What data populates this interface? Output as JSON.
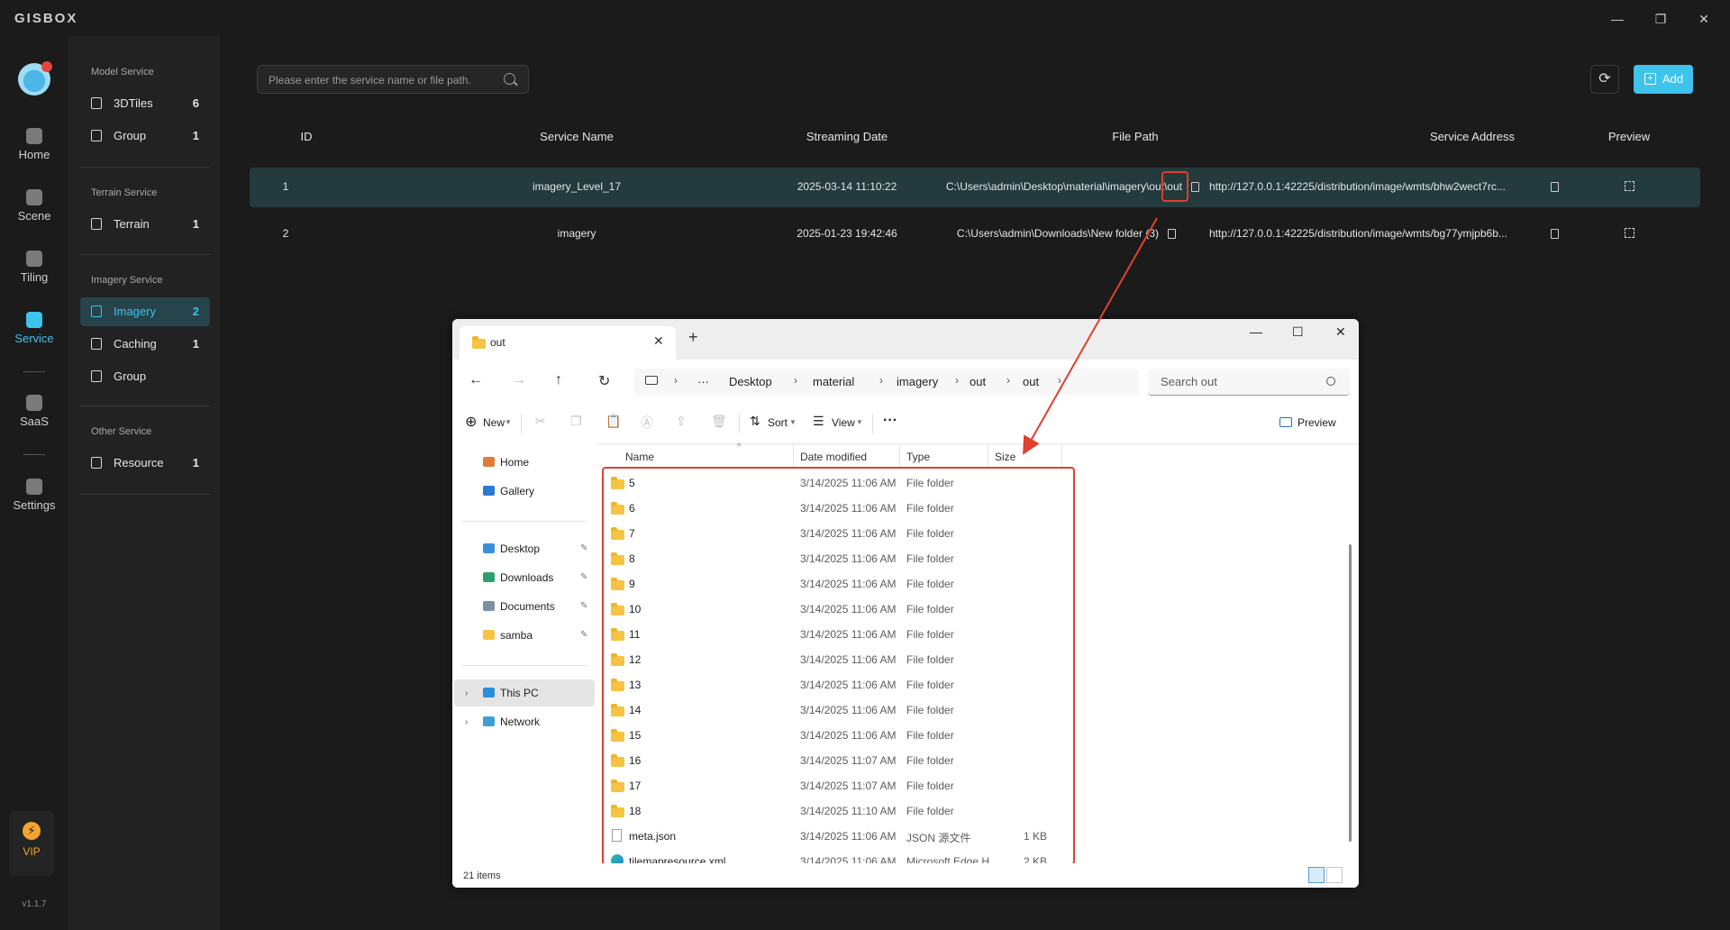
{
  "app": {
    "logo": "GISBOX",
    "window_controls": {
      "minimize": "—",
      "restore": "❐",
      "close": "✕"
    },
    "version": "v1.1.7"
  },
  "rail": {
    "items": [
      {
        "label": "Home",
        "icon": "home-icon"
      },
      {
        "label": "Scene",
        "icon": "scene-icon"
      },
      {
        "label": "Tiling",
        "icon": "tiling-icon"
      },
      {
        "label": "Service",
        "icon": "service-icon",
        "active": true
      },
      {
        "label": "SaaS",
        "icon": "saas-icon"
      },
      {
        "label": "Settings",
        "icon": "settings-icon"
      }
    ],
    "vip_label": "VIP",
    "vip_glyph": "⚡"
  },
  "sidebar": {
    "sections": [
      {
        "title": "Model Service",
        "items": [
          {
            "label": "3DTiles",
            "count": "6"
          },
          {
            "label": "Group",
            "count": "1"
          }
        ]
      },
      {
        "title": "Terrain Service",
        "items": [
          {
            "label": "Terrain",
            "count": "1"
          }
        ]
      },
      {
        "title": "Imagery Service",
        "items": [
          {
            "label": "Imagery",
            "count": "2",
            "active": true
          },
          {
            "label": "Caching",
            "count": "1"
          },
          {
            "label": "Group",
            "count": ""
          }
        ]
      },
      {
        "title": "Other Service",
        "items": [
          {
            "label": "Resource",
            "count": "1"
          }
        ]
      }
    ]
  },
  "main": {
    "search_placeholder": "Please enter the service name or file path.",
    "refresh_glyph": "⟳",
    "add_label": "Add",
    "add_glyph": "+",
    "columns": [
      "ID",
      "Service Name",
      "Streaming Date",
      "File Path",
      "Service Address",
      "Preview"
    ],
    "rows": [
      {
        "id": "1",
        "name": "imagery_Level_17",
        "date": "2025-03-14 11:10:22",
        "path": "C:\\Users\\admin\\Desktop\\material\\imagery\\out\\out",
        "address": "http://127.0.0.1:42225/distribution/image/wmts/bhw2wect7rc...",
        "selected": true
      },
      {
        "id": "2",
        "name": "imagery",
        "date": "2025-01-23 19:42:46",
        "path": "C:\\Users\\admin\\Downloads\\New folder (3)",
        "address": "http://127.0.0.1:42225/distribution/image/wmts/bg77ymjpb6b...",
        "selected": false
      }
    ]
  },
  "explorer": {
    "tab_title": "out",
    "tab_close": "✕",
    "new_tab": "+",
    "window_controls": {
      "minimize": "—",
      "maximize": "☐",
      "close": "✕"
    },
    "nav": {
      "back": "←",
      "forward": "→",
      "up": "↑",
      "refresh": "↻"
    },
    "breadcrumb": [
      "Desktop",
      "material",
      "imagery",
      "out",
      "out"
    ],
    "breadcrumb_more": "···",
    "search_placeholder": "Search out",
    "commands": {
      "new": "New",
      "sort": "Sort",
      "view": "View",
      "more": "···",
      "preview": "Preview"
    },
    "cmd_glyphs": {
      "new": "⊕",
      "cut": "✂",
      "copy": "❐",
      "paste": "📋",
      "rename": "Ⓐ",
      "share": "⇪",
      "delete": "🗑",
      "sort": "⇅",
      "view": "☰"
    },
    "nav_pane": {
      "top": [
        "Home",
        "Gallery"
      ],
      "quick": [
        "Desktop",
        "Downloads",
        "Documents",
        "samba"
      ],
      "bottom": [
        "This PC",
        "Network"
      ]
    },
    "columns": {
      "name": "Name",
      "date": "Date modified",
      "type": "Type",
      "size": "Size"
    },
    "files": [
      {
        "name": "5",
        "date": "3/14/2025 11:06 AM",
        "type": "File folder",
        "size": "",
        "kind": "folder"
      },
      {
        "name": "6",
        "date": "3/14/2025 11:06 AM",
        "type": "File folder",
        "size": "",
        "kind": "folder"
      },
      {
        "name": "7",
        "date": "3/14/2025 11:06 AM",
        "type": "File folder",
        "size": "",
        "kind": "folder"
      },
      {
        "name": "8",
        "date": "3/14/2025 11:06 AM",
        "type": "File folder",
        "size": "",
        "kind": "folder"
      },
      {
        "name": "9",
        "date": "3/14/2025 11:06 AM",
        "type": "File folder",
        "size": "",
        "kind": "folder"
      },
      {
        "name": "10",
        "date": "3/14/2025 11:06 AM",
        "type": "File folder",
        "size": "",
        "kind": "folder"
      },
      {
        "name": "11",
        "date": "3/14/2025 11:06 AM",
        "type": "File folder",
        "size": "",
        "kind": "folder"
      },
      {
        "name": "12",
        "date": "3/14/2025 11:06 AM",
        "type": "File folder",
        "size": "",
        "kind": "folder"
      },
      {
        "name": "13",
        "date": "3/14/2025 11:06 AM",
        "type": "File folder",
        "size": "",
        "kind": "folder"
      },
      {
        "name": "14",
        "date": "3/14/2025 11:06 AM",
        "type": "File folder",
        "size": "",
        "kind": "folder"
      },
      {
        "name": "15",
        "date": "3/14/2025 11:06 AM",
        "type": "File folder",
        "size": "",
        "kind": "folder"
      },
      {
        "name": "16",
        "date": "3/14/2025 11:07 AM",
        "type": "File folder",
        "size": "",
        "kind": "folder"
      },
      {
        "name": "17",
        "date": "3/14/2025 11:07 AM",
        "type": "File folder",
        "size": "",
        "kind": "folder"
      },
      {
        "name": "18",
        "date": "3/14/2025 11:10 AM",
        "type": "File folder",
        "size": "",
        "kind": "folder"
      },
      {
        "name": "meta.json",
        "date": "3/14/2025 11:06 AM",
        "type": "JSON 源文件",
        "size": "1 KB",
        "kind": "file"
      },
      {
        "name": "tilemapresource.xml",
        "date": "3/14/2025 11:06 AM",
        "type": "Microsoft Edge H...",
        "size": "2 KB",
        "kind": "edge"
      }
    ],
    "status": "21 items"
  },
  "colors": {
    "accent": "#3ec3ea",
    "highlight": "#e0402e",
    "selected_row": "#243a3d"
  }
}
